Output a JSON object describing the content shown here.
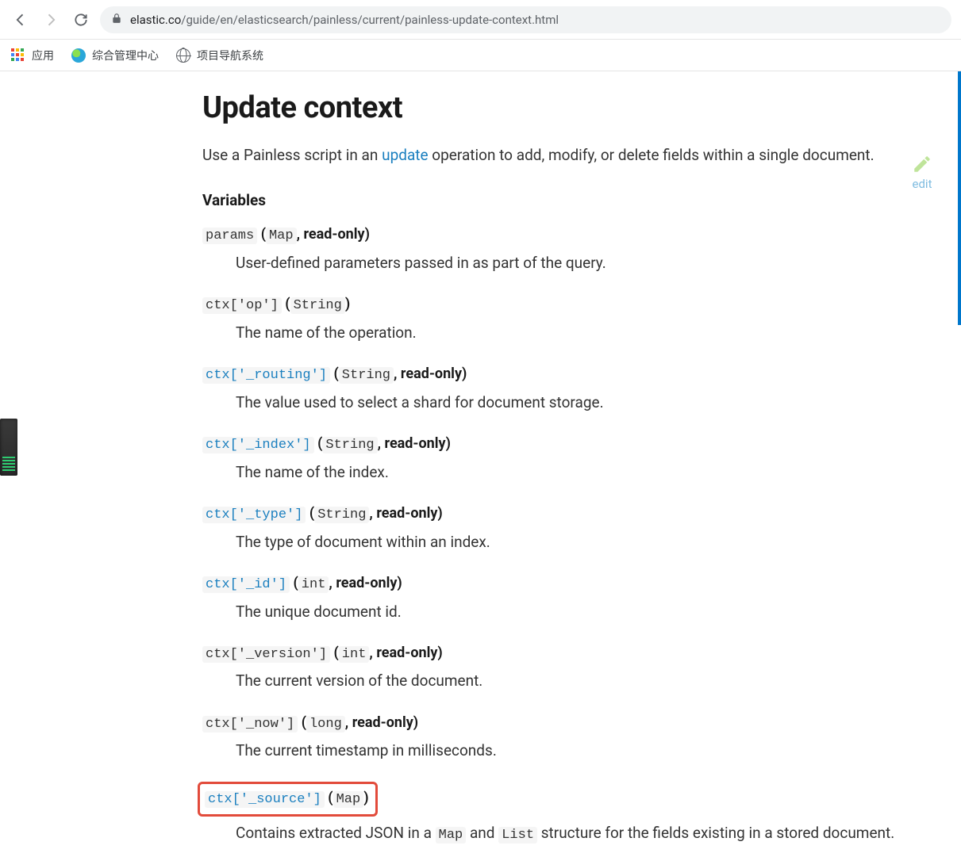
{
  "browser": {
    "url_host": "elastic.co",
    "url_path": "/guide/en/elasticsearch/painless/current/painless-update-context.html"
  },
  "bookmarks": {
    "apps": "应用",
    "items": [
      "综合管理中心",
      "项目导航系统"
    ]
  },
  "page": {
    "title": "Update context",
    "edit_label": "edit",
    "lead_pre": "Use a Painless script in an ",
    "lead_link": "update",
    "lead_post": " operation to add, modify, or delete fields within a single document.",
    "section_variables": "Variables"
  },
  "variables": [
    {
      "name": "params",
      "name_link": false,
      "type": "Map",
      "readonly": true,
      "desc": "User-defined parameters passed in as part of the query."
    },
    {
      "name": "ctx['op']",
      "name_link": false,
      "type": "String",
      "readonly": false,
      "desc": "The name of the operation."
    },
    {
      "name": "ctx['_routing']",
      "name_link": true,
      "type": "String",
      "readonly": true,
      "desc": "The value used to select a shard for document storage."
    },
    {
      "name": "ctx['_index']",
      "name_link": true,
      "type": "String",
      "readonly": true,
      "desc": "The name of the index."
    },
    {
      "name": "ctx['_type']",
      "name_link": true,
      "type": "String",
      "readonly": true,
      "desc": "The type of document within an index."
    },
    {
      "name": "ctx['_id']",
      "name_link": true,
      "type": "int",
      "readonly": true,
      "desc": "The unique document id."
    },
    {
      "name": "ctx['_version']",
      "name_link": false,
      "type": "int",
      "readonly": true,
      "desc": "The current version of the document."
    },
    {
      "name": "ctx['_now']",
      "name_link": false,
      "type": "long",
      "readonly": true,
      "desc": "The current timestamp in milliseconds."
    },
    {
      "name": "ctx['_source']",
      "name_link": true,
      "type": "Map",
      "readonly": false,
      "highlight": true,
      "desc_pre": "Contains extracted JSON in a ",
      "desc_code1": "Map",
      "desc_mid": " and ",
      "desc_code2": "List",
      "desc_post": " structure for the fields existing in a stored document."
    }
  ]
}
